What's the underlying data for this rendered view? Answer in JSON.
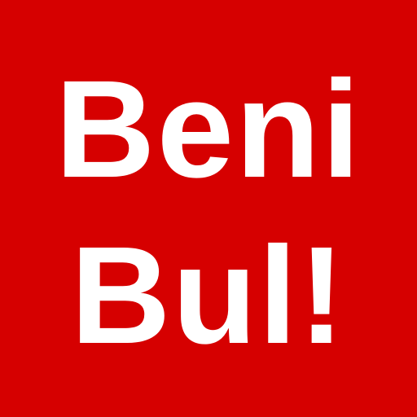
{
  "tile": {
    "line1": "Beni",
    "line2": "Bul!"
  },
  "colors": {
    "background": "#d60000",
    "text": "#ffffff"
  }
}
